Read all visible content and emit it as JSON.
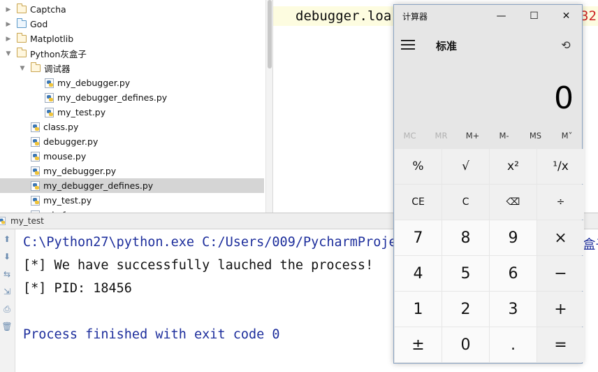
{
  "tree": {
    "items": [
      {
        "label": "Captcha",
        "kind": "folder",
        "color": "yellow",
        "arrow": "right",
        "indent": 0
      },
      {
        "label": "God",
        "kind": "folder",
        "color": "blue",
        "arrow": "right",
        "indent": 0
      },
      {
        "label": "Matplotlib",
        "kind": "folder",
        "color": "yellow",
        "arrow": "right",
        "indent": 0
      },
      {
        "label": "Python灰盒子",
        "kind": "folder",
        "color": "yellow",
        "arrow": "down",
        "indent": 0
      },
      {
        "label": "调试器",
        "kind": "folder",
        "color": "yellow",
        "arrow": "down",
        "indent": 1
      },
      {
        "label": "my_debugger.py",
        "kind": "py",
        "indent": 2
      },
      {
        "label": "my_debugger_defines.py",
        "kind": "py",
        "indent": 2
      },
      {
        "label": "my_test.py",
        "kind": "py",
        "indent": 2
      },
      {
        "label": "class.py",
        "kind": "py",
        "indent": 1
      },
      {
        "label": "debugger.py",
        "kind": "py",
        "indent": 1
      },
      {
        "label": "mouse.py",
        "kind": "py",
        "indent": 1
      },
      {
        "label": "my_debugger.py",
        "kind": "py",
        "indent": 1
      },
      {
        "label": "my_debugger_defines.py",
        "kind": "py",
        "indent": 1,
        "selected": true
      },
      {
        "label": "my_test.py",
        "kind": "py",
        "indent": 1
      },
      {
        "label": "ode.f...",
        "kind": "py",
        "indent": 1
      }
    ]
  },
  "editor": {
    "code": "debugger.loa",
    "code_tail": "32"
  },
  "run": {
    "tab_label": "my_test",
    "console": [
      {
        "text": "C:\\Python27\\python.exe C:/Users/009/PycharmProje",
        "style": "blue"
      },
      {
        "text": "[*] We have successfully lauched the process!",
        "style": "dark"
      },
      {
        "text": "[*] PID: 18456",
        "style": "dark"
      },
      {
        "text": "",
        "style": "dark"
      },
      {
        "text": "Process finished with exit code 0",
        "style": "blue"
      }
    ],
    "console_tail": "盒子"
  },
  "calculator": {
    "title": "计算器",
    "mode": "标准",
    "display": "0",
    "window_buttons": {
      "minimize": "—",
      "maximize": "☐",
      "close": "✕"
    },
    "memory": [
      {
        "label": "MC",
        "enabled": false
      },
      {
        "label": "MR",
        "enabled": false
      },
      {
        "label": "M+",
        "enabled": true
      },
      {
        "label": "M-",
        "enabled": true
      },
      {
        "label": "MS",
        "enabled": true
      },
      {
        "label": "M˅",
        "enabled": true
      }
    ],
    "keys": [
      [
        "%",
        "√",
        "x²",
        "¹/x"
      ],
      [
        "CE",
        "C",
        "⌫",
        "÷"
      ],
      [
        "7",
        "8",
        "9",
        "×"
      ],
      [
        "4",
        "5",
        "6",
        "−"
      ],
      [
        "1",
        "2",
        "3",
        "+"
      ],
      [
        "±",
        "0",
        ".",
        "="
      ]
    ]
  }
}
